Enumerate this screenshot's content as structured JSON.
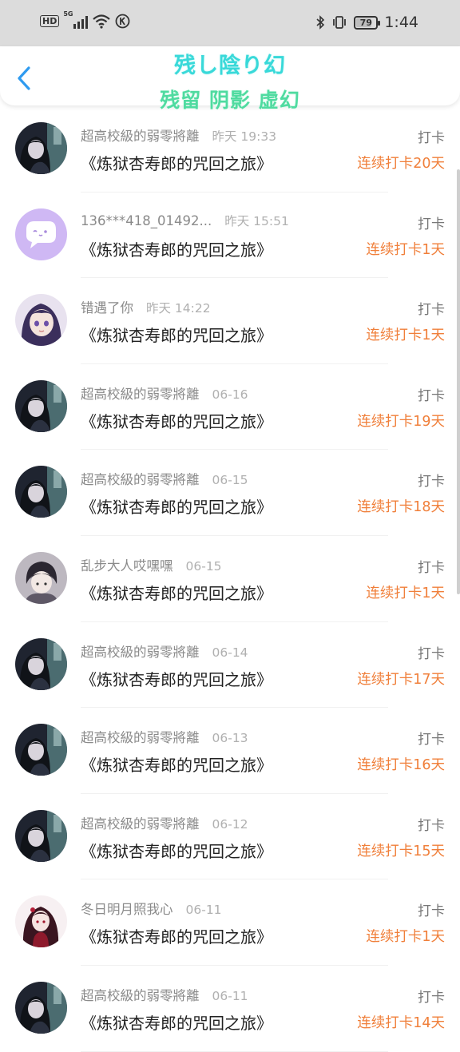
{
  "status_bar": {
    "left_labels": {
      "hd": "HD",
      "network": "5G"
    },
    "battery": "79",
    "battery_level": 0.79,
    "time": "1:44"
  },
  "header": {
    "title_line1": "残し陰り幻",
    "title_line2": "残留 阴影 虚幻"
  },
  "list": [
    {
      "user": "超高校級的弱零將離",
      "time": "昨天 19:33",
      "book": "《炼狱杏寿郎的咒回之旅》",
      "type": "打卡",
      "streak": "连续打卡20天",
      "avatar": "dark"
    },
    {
      "user": "136***418_01492...",
      "time": "昨天 15:51",
      "book": "《炼狱杏寿郎的咒回之旅》",
      "type": "打卡",
      "streak": "连续打卡1天",
      "avatar": "default-chat"
    },
    {
      "user": "错遇了你",
      "time": "昨天 14:22",
      "book": "《炼狱杏寿郎的咒回之旅》",
      "type": "打卡",
      "streak": "连续打卡1天",
      "avatar": "anime-purple"
    },
    {
      "user": "超高校級的弱零將離",
      "time": "06-16",
      "book": "《炼狱杏寿郎的咒回之旅》",
      "type": "打卡",
      "streak": "连续打卡19天",
      "avatar": "dark"
    },
    {
      "user": "超高校級的弱零將離",
      "time": "06-15",
      "book": "《炼狱杏寿郎的咒回之旅》",
      "type": "打卡",
      "streak": "连续打卡18天",
      "avatar": "dark"
    },
    {
      "user": "乱步大人哎嘿嘿",
      "time": "06-15",
      "book": "《炼狱杏寿郎的咒回之旅》",
      "type": "打卡",
      "streak": "连续打卡1天",
      "avatar": "anime-gray"
    },
    {
      "user": "超高校級的弱零將離",
      "time": "06-14",
      "book": "《炼狱杏寿郎的咒回之旅》",
      "type": "打卡",
      "streak": "连续打卡17天",
      "avatar": "dark"
    },
    {
      "user": "超高校級的弱零將離",
      "time": "06-13",
      "book": "《炼狱杏寿郎的咒回之旅》",
      "type": "打卡",
      "streak": "连续打卡16天",
      "avatar": "dark"
    },
    {
      "user": "超高校級的弱零將離",
      "time": "06-12",
      "book": "《炼狱杏寿郎的咒回之旅》",
      "type": "打卡",
      "streak": "连续打卡15天",
      "avatar": "dark"
    },
    {
      "user": "冬日明月照我心",
      "time": "06-11",
      "book": "《炼狱杏寿郎的咒回之旅》",
      "type": "打卡",
      "streak": "连续打卡1天",
      "avatar": "anime-red"
    },
    {
      "user": "超高校級的弱零將離",
      "time": "06-11",
      "book": "《炼狱杏寿郎的咒回之旅》",
      "type": "打卡",
      "streak": "连续打卡14天",
      "avatar": "dark"
    }
  ],
  "colors": {
    "accent_title": "#39d9d9",
    "accent_title2": "#4fdba0",
    "streak": "#f07f3a",
    "back": "#2f9bf0"
  },
  "icons": {
    "back": "chevron-left-icon",
    "wifi": "wifi-icon",
    "signal": "signal-icon",
    "bluetooth": "bluetooth-icon",
    "vibrate": "vibrate-icon",
    "k_app": "k-circle-icon"
  }
}
